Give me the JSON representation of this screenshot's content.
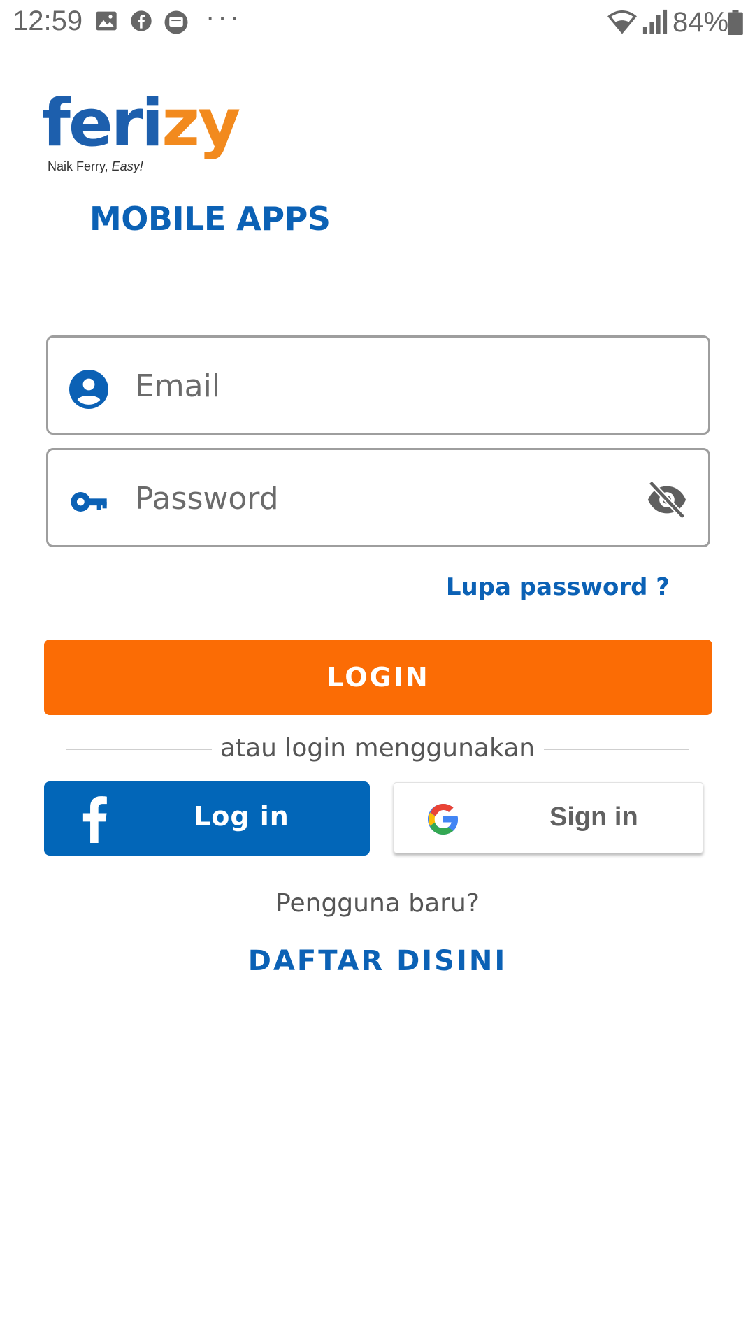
{
  "status_bar": {
    "time": "12:59",
    "notification_icons": [
      "image-icon",
      "facebook-icon",
      "message-icon"
    ],
    "more": "···",
    "battery_percent": "84%"
  },
  "logo": {
    "brand_part1": "feri",
    "brand_part2": "zy",
    "tagline_plain": "Naik Ferry, ",
    "tagline_italic": "Easy!"
  },
  "app_subtitle": "MOBILE APPS",
  "login_form": {
    "email_placeholder": "Email",
    "password_placeholder": "Password",
    "forgot_password": "Lupa password ?",
    "login_label": "LOGIN"
  },
  "social": {
    "divider_text": "atau login menggunakan",
    "facebook_label": "Log in",
    "google_label": "Sign in"
  },
  "register": {
    "prompt": "Pengguna baru?",
    "link_label": "DAFTAR DISINI"
  },
  "colors": {
    "brand_blue": "#0b61b5",
    "brand_orange": "#fb6c05",
    "facebook_blue": "#0266b8"
  }
}
